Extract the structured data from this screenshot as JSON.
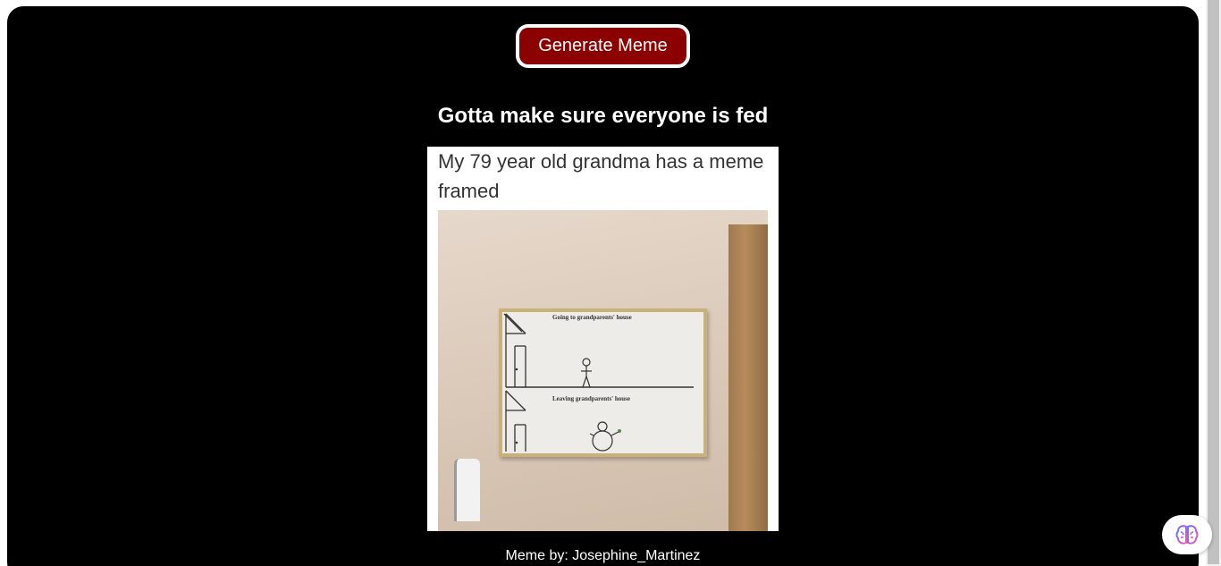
{
  "app": {
    "generate_label": "Generate Meme"
  },
  "meme": {
    "title": "Gotta make sure everyone is fed",
    "image_caption": "My 79 year old grandma has a meme framed",
    "frame_text_top": "Going to grandparents' house",
    "frame_text_bottom": "Leaving grandparents' house",
    "credit": "Meme by: Josephine_Martinez"
  },
  "floating": {
    "icon": "brain-icon"
  },
  "colors": {
    "background": "#000000",
    "button": "#8b0000",
    "text": "#ffffff"
  }
}
